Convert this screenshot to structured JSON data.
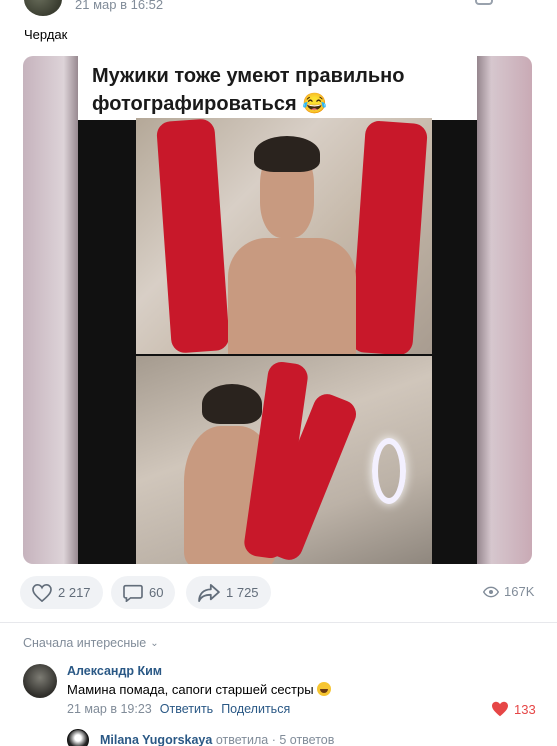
{
  "post": {
    "date": "21 мар в 16:52",
    "text": "Чердак",
    "media_caption": "Мужики тоже умеют правильно фотографироваться 😂"
  },
  "actions": {
    "likes": "2 217",
    "comments": "60",
    "shares": "1 725",
    "views": "167K"
  },
  "comments": {
    "sort_label": "Сначала интересные",
    "items": [
      {
        "author": "Александр Ким",
        "text": "Мамина помада, сапоги старшей сестры",
        "date": "21 мар в 19:23",
        "reply_link": "Ответить",
        "share_link": "Поделиться",
        "likes": "133"
      }
    ],
    "reply_preview": {
      "name": "Milana Yugorskaya",
      "action": "ответила",
      "separator": "·",
      "count": "5 ответов"
    }
  },
  "colors": {
    "link": "#2a5885",
    "muted": "#818c99",
    "pill_bg": "#f0f2f5",
    "like_red": "#e64646"
  }
}
